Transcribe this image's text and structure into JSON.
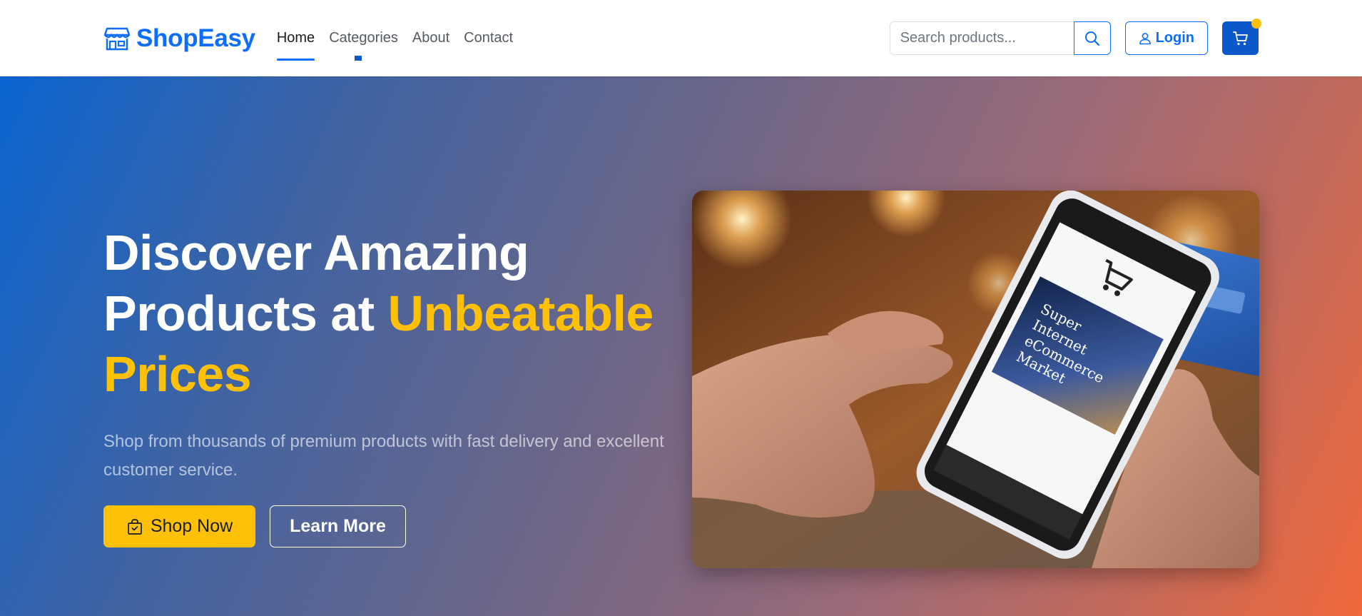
{
  "brand": {
    "name": "ShopEasy",
    "icon": "shop-icon",
    "color": "#0d6efd"
  },
  "nav": {
    "links": [
      {
        "label": "Home",
        "active": true
      },
      {
        "label": "Categories",
        "active": false
      },
      {
        "label": "About",
        "active": false
      },
      {
        "label": "Contact",
        "active": false
      }
    ]
  },
  "search": {
    "placeholder": "Search products...",
    "value": "",
    "icon": "search-icon"
  },
  "login": {
    "label": "Login",
    "icon": "person-icon"
  },
  "cart": {
    "icon": "cart-icon",
    "badge_color": "#ffc107"
  },
  "hero": {
    "title_line1": "Discover Amazing",
    "title_line2": "Products at ",
    "title_accent_a": "Unbeatable",
    "title_accent_b": "Prices",
    "subtitle": "Shop from thousands of premium products with fast delivery and excellent customer service.",
    "primary_button": {
      "label": "Shop Now",
      "icon": "shopping-bag-icon"
    },
    "secondary_button": {
      "label": "Learn More"
    },
    "image_alt": "Hands holding a smartphone showing an online shop and a credit card",
    "phone_screen_text": [
      "Super",
      "Internet",
      "eCommerce",
      "Market"
    ],
    "accent_color": "#ffc107",
    "gradient": [
      "#0a64d0",
      "#6a6689",
      "#f0683b"
    ]
  }
}
